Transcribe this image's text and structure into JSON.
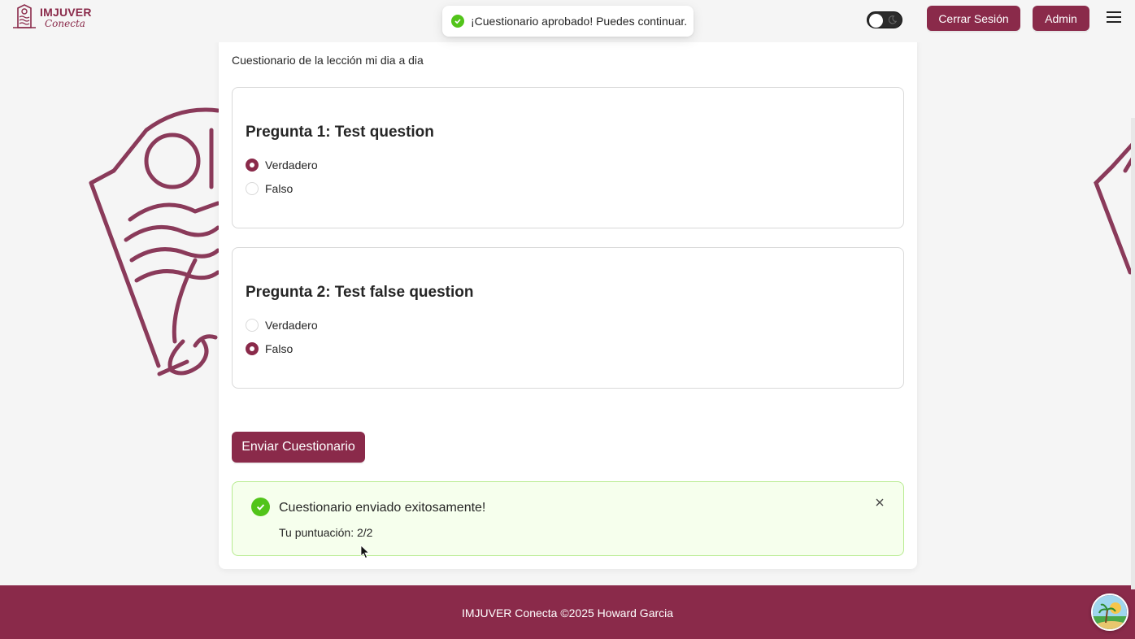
{
  "header": {
    "logo_title": "IMJUVER",
    "logo_subtitle": "Conecta",
    "logout_label": "Cerrar Sesión",
    "admin_label": "Admin",
    "icons": [
      "check-circle-icon",
      "moon-icon",
      "hamburger-menu-icon"
    ]
  },
  "toast": {
    "message": "¡Cuestionario aprobado! Puedes continuar."
  },
  "quiz": {
    "description": "Cuestionario de la lección mi dia a dia",
    "questions": [
      {
        "title": "Pregunta 1: Test question",
        "options": [
          {
            "label": "Verdadero",
            "selected": true
          },
          {
            "label": "Falso",
            "selected": false
          }
        ]
      },
      {
        "title": "Pregunta 2: Test false question",
        "options": [
          {
            "label": "Verdadero",
            "selected": false
          },
          {
            "label": "Falso",
            "selected": true
          }
        ]
      }
    ],
    "submit_label": "Enviar Cuestionario"
  },
  "result": {
    "title": "Cuestionario enviado exitosamente!",
    "score": "Tu puntuación: 2/2"
  },
  "footer": {
    "text": "IMJUVER Conecta ©2025 Howard Garcia"
  },
  "colors": {
    "brand": "#8a2a4a",
    "success": "#52c41a",
    "success_bg": "#f6ffed",
    "footer_bg": "#8a2a4a"
  }
}
